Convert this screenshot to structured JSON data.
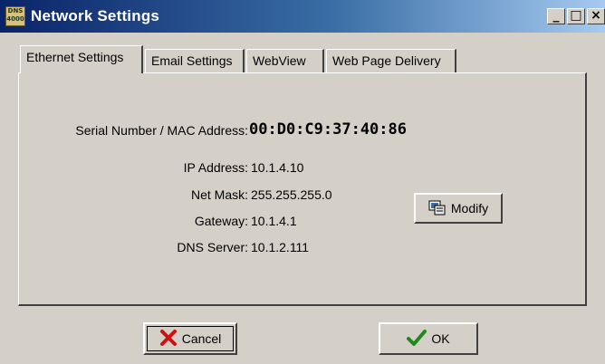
{
  "window": {
    "title": "Network Settings",
    "app_icon_text": "DNS 4000",
    "minimize_label": "_",
    "maximize_label": "□",
    "close_label": "×"
  },
  "tabs": [
    {
      "label": "Ethernet Settings",
      "active": true
    },
    {
      "label": "Email Settings",
      "active": false
    },
    {
      "label": "WebView",
      "active": false
    },
    {
      "label": "Web Page Delivery",
      "active": false
    }
  ],
  "ethernet": {
    "mac_label": "Serial Number / MAC Address:",
    "mac_value": "00:D0:C9:37:40:86",
    "ip_label": "IP Address:",
    "ip_value": "10.1.4.10",
    "netmask_label": "Net Mask:",
    "netmask_value": "255.255.255.0",
    "gateway_label": "Gateway:",
    "gateway_value": "10.1.4.1",
    "dns_label": "DNS Server:",
    "dns_value": "10.1.2.111",
    "modify_label": "Modify"
  },
  "buttons": {
    "cancel_label": "Cancel",
    "ok_label": "OK"
  },
  "colors": {
    "titlebar_start": "#0a246a",
    "titlebar_end": "#a6caf0",
    "cancel_x": "#d01010",
    "ok_check": "#1e8a1e"
  }
}
